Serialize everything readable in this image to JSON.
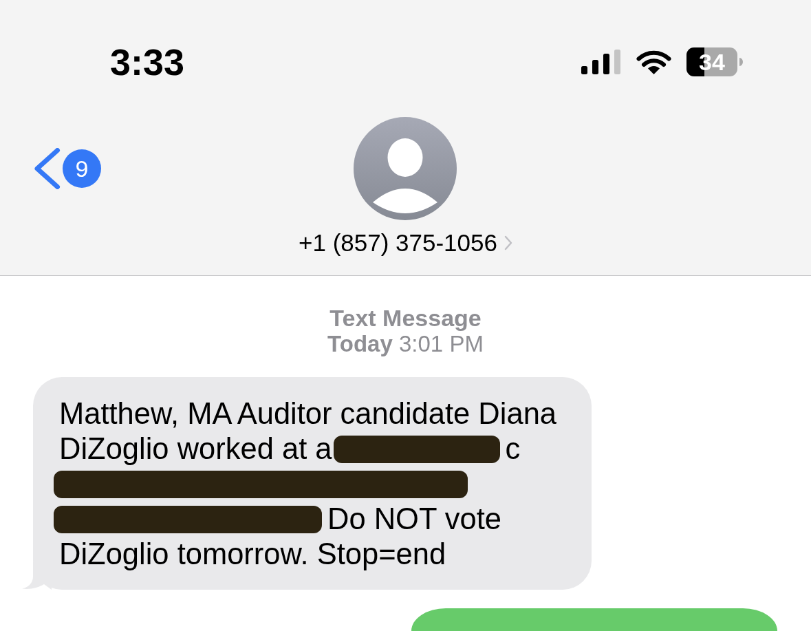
{
  "status_bar": {
    "time": "3:33",
    "battery": "34"
  },
  "header": {
    "back_badge": "9",
    "contact": "+1 (857) 375-1056"
  },
  "conversation": {
    "service": "Text Message",
    "timestamp": "**Today** 3:01 PM",
    "messages": [
      {
        "kind": "incoming",
        "lines": [
          {
            "segments": [
              {
                "kind": "text",
                "text": "Matthew, MA Auditor candidate Diana"
              }
            ]
          },
          {
            "segments": [
              {
                "kind": "text",
                "text": "DiZoglio worked at a"
              },
              {
                "kind": "redaction"
              },
              {
                "kind": "text",
                "text": "c"
              }
            ]
          },
          {
            "segments": [
              {
                "kind": "redaction"
              }
            ]
          },
          {
            "segments": [
              {
                "kind": "redaction"
              },
              {
                "kind": "text",
                "text": "Do NOT vote"
              }
            ]
          },
          {
            "segments": [
              {
                "kind": "text",
                "text": "DiZoglio tomorrow. Stop=end"
              }
            ]
          }
        ]
      },
      {
        "kind": "outgoing"
      }
    ]
  }
}
